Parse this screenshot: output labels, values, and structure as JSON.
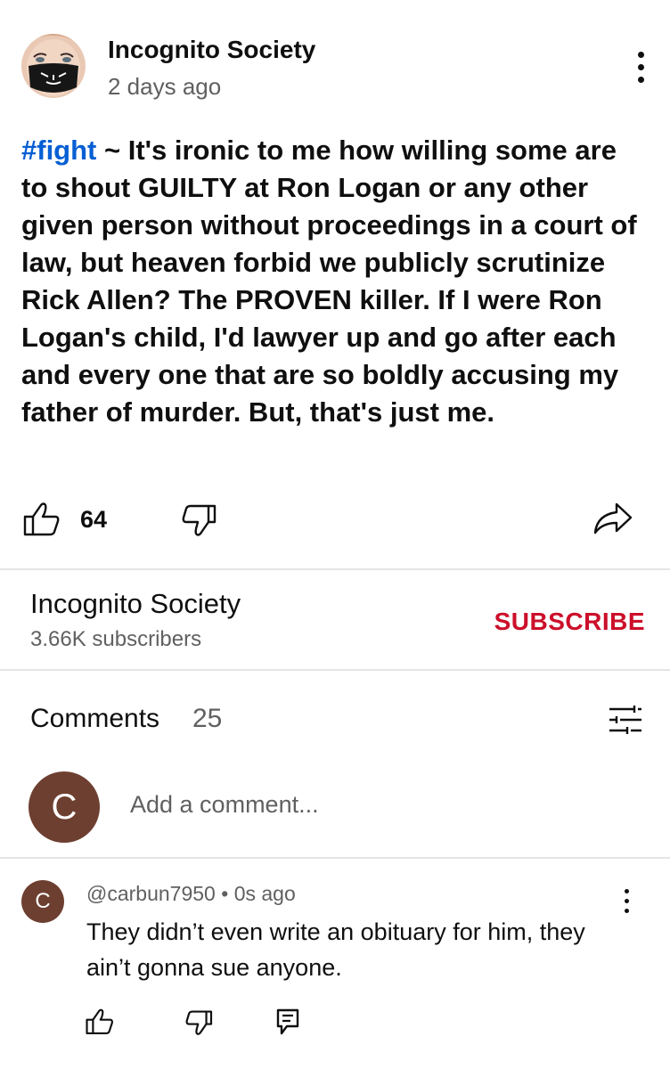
{
  "post": {
    "channel_name": "Incognito Society",
    "time_ago": "2 days ago",
    "hashtag": "#fight",
    "body": " ~ It's ironic to me how willing some are to shout GUILTY at Ron Logan or any other given person without proceedings in a court of law, but heaven forbid we publicly scrutinize Rick Allen? The PROVEN killer.  If I were Ron Logan's child, I'd lawyer up and go after each and every one that are so boldly accusing my father of murder. But, that's just me.",
    "like_count": "64",
    "hashtag_color": "#065fd4"
  },
  "channel": {
    "name": "Incognito Society",
    "subscribers": "3.66K subscribers",
    "subscribe_label": "SUBSCRIBE",
    "subscribe_color": "#cc0f2a"
  },
  "comments": {
    "label": "Comments",
    "count": "25",
    "add_placeholder": "Add a comment...",
    "user_initial": "C",
    "items": [
      {
        "avatar_initial": "C",
        "author": "@carbun7950",
        "separator": "•",
        "time_ago": "0s ago",
        "text": "They didn’t even write an obituary for him, they ain’t gonna sue anyone."
      }
    ]
  },
  "icons": {
    "post_menu": "vertical-dots-icon",
    "like": "thumbs-up-icon",
    "dislike": "thumbs-down-icon",
    "share": "share-arrow-icon",
    "sort": "sliders-icon",
    "reply": "reply-comment-icon"
  }
}
